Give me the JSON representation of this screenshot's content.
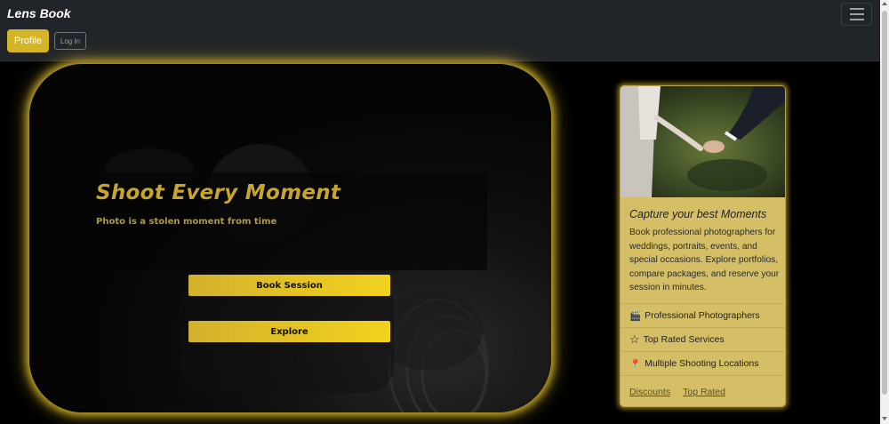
{
  "navbar": {
    "brand": "Lens Book",
    "profile_label": "Profile",
    "login_label": "Log In"
  },
  "hero": {
    "title": "Shoot Every Moment",
    "subtitle": "Photo is a stolen moment from time",
    "book_label": "Book Session",
    "explore_label": "Explore"
  },
  "card": {
    "title": "Capture your best Moments",
    "text": "Book professional photographers for weddings, portraits, events, and special occasions. Explore portfolios, compare packages, and reserve your session in minutes.",
    "features": [
      {
        "icon": "🎬",
        "icon_name": "clapper-icon",
        "label": "Professional Photographers"
      },
      {
        "icon": "☆",
        "icon_name": "star-icon",
        "label": "Top Rated Services"
      },
      {
        "icon": "📍",
        "icon_name": "pin-icon",
        "label": "Multiple Shooting Locations"
      }
    ],
    "links": [
      "Discounts",
      "Top Rated"
    ]
  },
  "colors": {
    "accent": "#d4b52a",
    "navbar_bg": "#212529",
    "card_bg": "#d4bf66"
  }
}
